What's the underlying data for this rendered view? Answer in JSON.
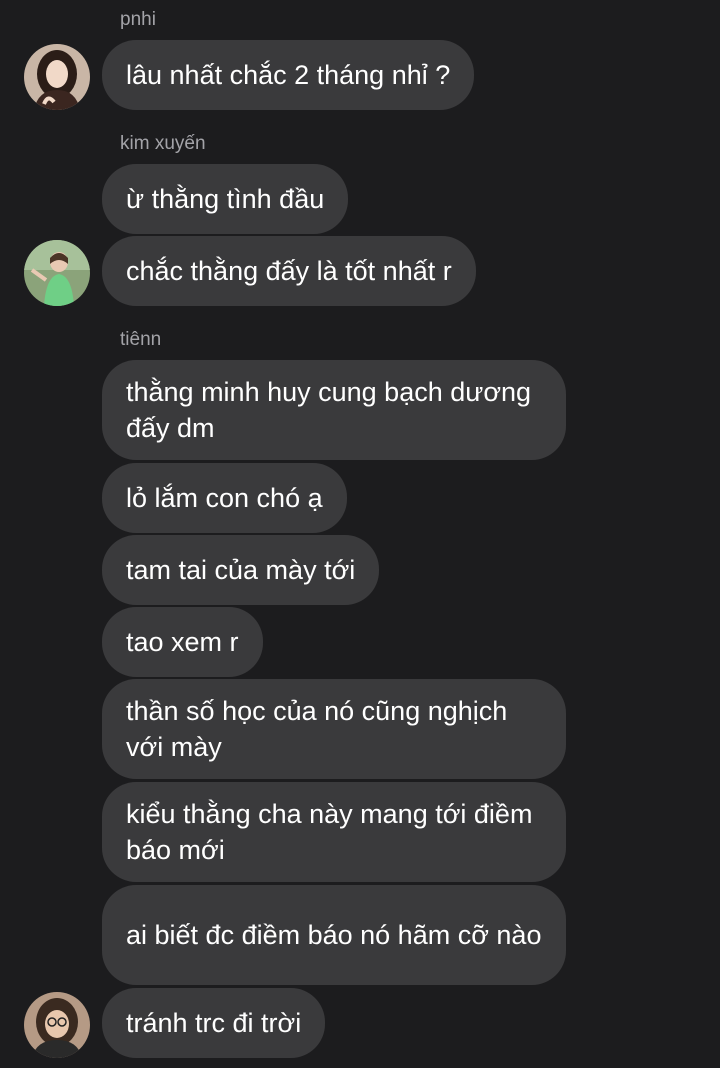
{
  "conversation": {
    "groups": [
      {
        "sender": "pnhi",
        "avatar_icon": "avatar-girl-dark-hair",
        "messages": [
          "lâu nhất chắc 2 tháng nhỉ ?"
        ]
      },
      {
        "sender": "kim xuyến",
        "avatar_icon": "avatar-girl-green-shirt",
        "messages": [
          "ừ thằng tình đầu",
          "chắc thằng đấy là tốt nhất r"
        ]
      },
      {
        "sender": "tiênn",
        "avatar_icon": "avatar-girl-glasses",
        "messages": [
          "thằng minh huy cung bạch dương đấy dm",
          "lỏ lắm con chó ạ",
          "tam tai của mày tới",
          "tao xem r",
          "thần số học của nó cũng nghịch với mày",
          "kiểu thằng cha này mang tới điềm báo mới",
          "ai biết đc điềm báo nó hãm cỡ nào",
          "tránh trc đi trời"
        ]
      }
    ]
  },
  "colors": {
    "background": "#1c1c1e",
    "bubble": "#3a3a3c",
    "sender_name": "#a3a3a8",
    "text": "#ffffff"
  }
}
